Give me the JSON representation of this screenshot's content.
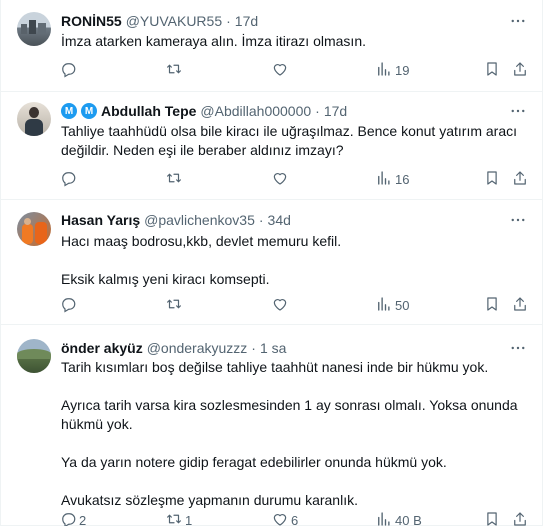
{
  "colors": {
    "accent": "#1d9bf0",
    "secondary_text": "#536471",
    "divider": "#eff3f4"
  },
  "tweets": [
    {
      "name": "RONİN55",
      "handle": "@YUVAKUR55",
      "separator": "·",
      "time": "17d",
      "verified_badges": [],
      "lines": [
        "İmza atarken kameraya alın. İmza itirazı olmasın."
      ],
      "stats": {
        "replies": "",
        "retweets": "",
        "likes": "",
        "views": "19"
      },
      "avatar": "city-skyline-avatar"
    },
    {
      "name": "Abdullah Tepe",
      "handle": "@Abdillah000000",
      "separator": "·",
      "time": "17d",
      "verified_badges": [
        "M",
        "M"
      ],
      "lines": [
        "Tahliye taahhüdü olsa bile kiracı ile uğraşılmaz. Bence konut yatırım aracı",
        "değildir. Neden eşi ile beraber aldınız imzayı?"
      ],
      "stats": {
        "replies": "",
        "retweets": "",
        "likes": "",
        "views": "16"
      },
      "avatar": "person-avatar"
    },
    {
      "name": "Hasan Yarış",
      "handle": "@pavlichenkov35",
      "separator": "·",
      "time": "34d",
      "verified_badges": [],
      "lines": [
        "Hacı maaş bodrosu,kkb, devlet memuru kefil.",
        "",
        "Eksik kalmış yeni kiracı komsepti."
      ],
      "stats": {
        "replies": "",
        "retweets": "",
        "likes": "",
        "views": "50"
      },
      "avatar": "orange-workers-avatar"
    },
    {
      "name": "önder akyüz",
      "handle": "@onderakyuzzz",
      "separator": "·",
      "time": "1 sa",
      "verified_badges": [],
      "lines": [
        "Tarih kısımları boş değilse tahliye taahhüt nanesi inde bir hükmu yok.",
        "",
        "Ayrıca tarih varsa kira sozlesmesinden 1 ay sonrası olmalı. Yoksa onunda",
        "hükmü yok.",
        "",
        "Ya da yarın notere gidip feragat edebilirler onunda hükmü yok.",
        "",
        "Avukatsız sözleşme yapmanın durumu karanlık."
      ],
      "stats": {
        "replies": "2",
        "retweets": "1",
        "likes": "6",
        "views": "40 B"
      },
      "avatar": "landscape-avatar"
    }
  ]
}
